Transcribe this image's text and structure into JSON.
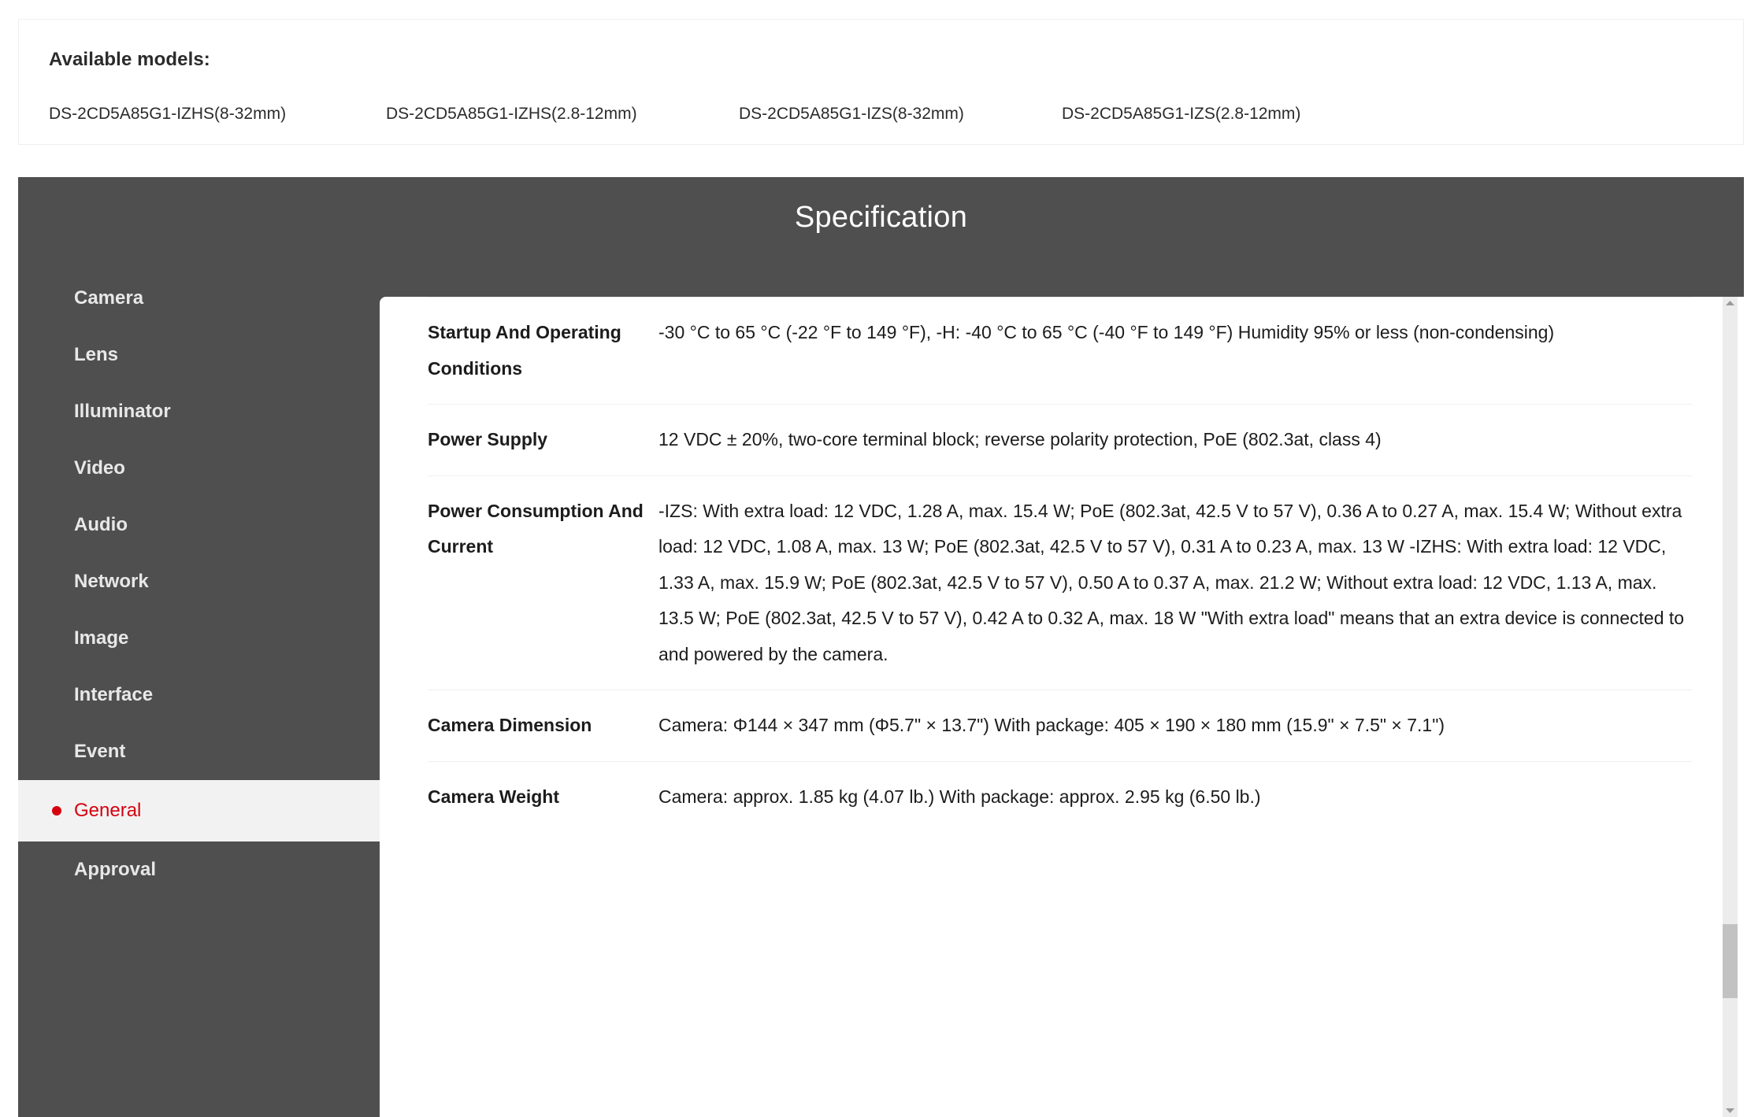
{
  "models_box": {
    "title": "Available models:",
    "models": [
      "DS-2CD5A85G1-IZHS(8-32mm)",
      "DS-2CD5A85G1-IZHS(2.8-12mm)",
      "DS-2CD5A85G1-IZS(8-32mm)",
      "DS-2CD5A85G1-IZS(2.8-12mm)"
    ]
  },
  "specification": {
    "heading": "Specification",
    "accent_color": "#d6000f",
    "panel_background": "#4f4f4f",
    "sidebar": {
      "items": [
        {
          "label": "Camera",
          "active": false
        },
        {
          "label": "Lens",
          "active": false
        },
        {
          "label": "Illuminator",
          "active": false
        },
        {
          "label": "Video",
          "active": false
        },
        {
          "label": "Audio",
          "active": false
        },
        {
          "label": "Network",
          "active": false
        },
        {
          "label": "Image",
          "active": false
        },
        {
          "label": "Interface",
          "active": false
        },
        {
          "label": "Event",
          "active": false
        },
        {
          "label": "General",
          "active": true
        },
        {
          "label": "Approval",
          "active": false
        }
      ]
    },
    "table": {
      "rows": [
        {
          "key": "Startup And Operating Conditions",
          "value": "-30 °C to 65 °C (-22 °F to 149 °F), -H: -40 °C to 65 °C (-40 °F to 149 °F) Humidity 95% or less (non-condensing)"
        },
        {
          "key": "Power Supply",
          "value": "12 VDC ± 20%, two-core terminal block; reverse polarity protection, PoE (802.3at, class 4)"
        },
        {
          "key": "Power Consumption And Current",
          "value": "-IZS: With extra load: 12 VDC, 1.28 A, max. 15.4 W; PoE (802.3at, 42.5 V to 57 V), 0.36 A to 0.27 A, max. 15.4 W; Without extra load: 12 VDC, 1.08 A, max. 13 W; PoE (802.3at, 42.5 V to 57 V), 0.31 A to 0.23 A, max. 13 W -IZHS: With extra load: 12 VDC, 1.33 A, max. 15.9 W; PoE (802.3at, 42.5 V to 57 V), 0.50 A to 0.37 A, max. 21.2 W; Without extra load: 12 VDC, 1.13 A, max. 13.5 W; PoE (802.3at, 42.5 V to 57 V), 0.42 A to 0.32 A, max. 18 W \"With extra load\" means that an extra device is connected to and powered by the camera."
        },
        {
          "key": "Camera Dimension",
          "value": "Camera: Φ144 × 347 mm (Φ5.7\" × 13.7\") With package: 405 × 190 × 180 mm (15.9\" × 7.5\" × 7.1\")"
        },
        {
          "key": "Camera Weight",
          "value": "Camera: approx. 1.85 kg (4.07 lb.) With package: approx. 2.95 kg (6.50 lb.)"
        }
      ]
    },
    "scrollbar": {
      "up_arrow": "scroll-up-arrow",
      "down_arrow": "scroll-down-arrow"
    }
  }
}
